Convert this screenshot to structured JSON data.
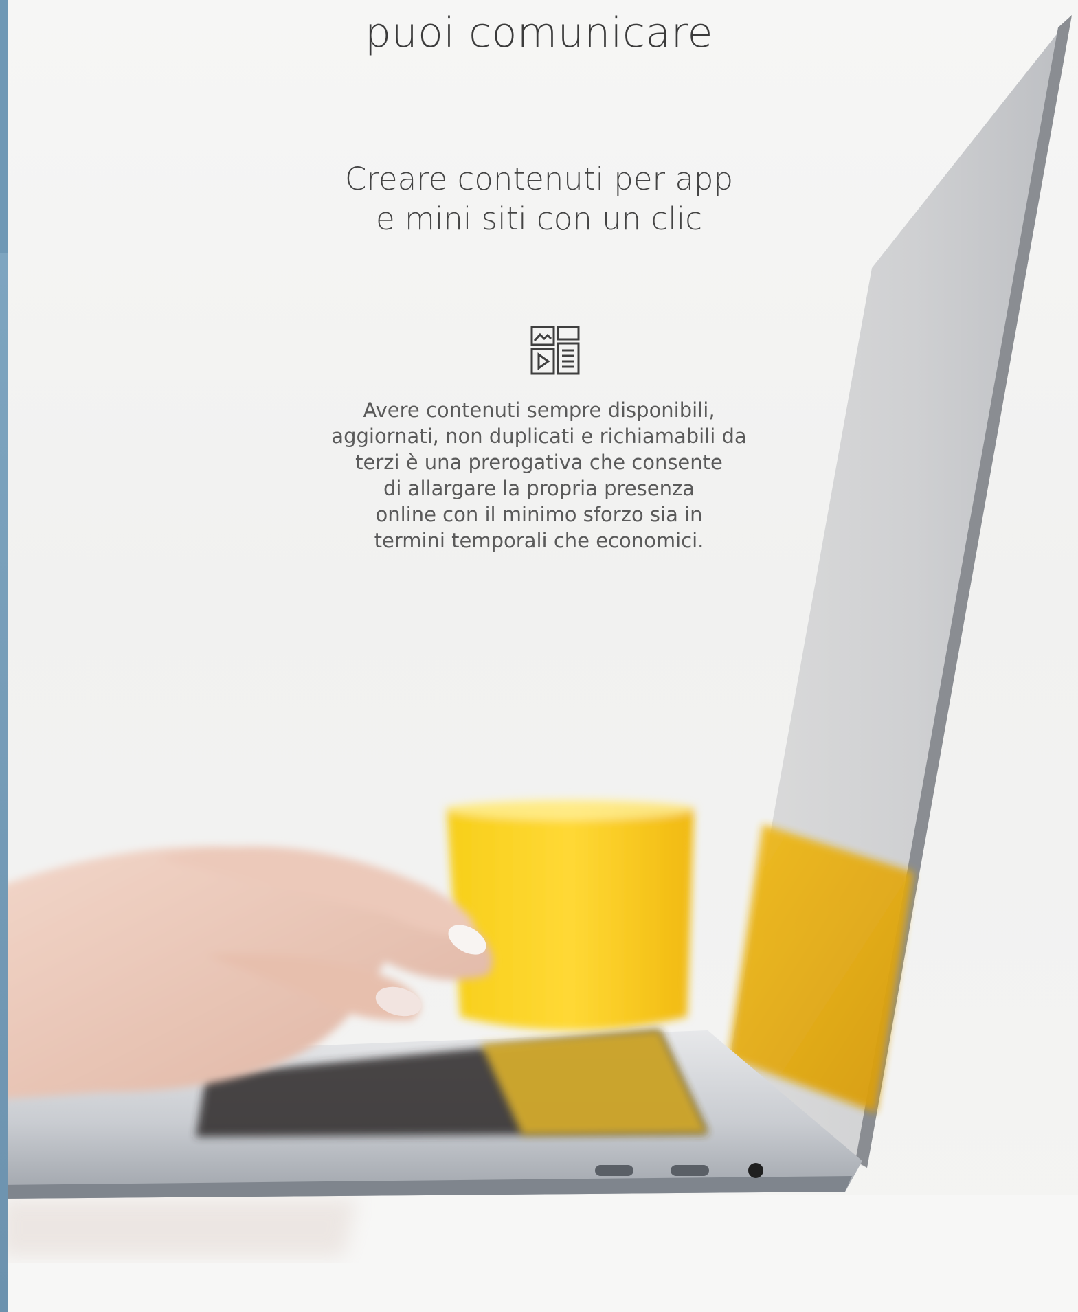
{
  "hero": {
    "headline": "puoi comunicare",
    "subtitle_lines": [
      "Creare contenuti per app",
      "e mini siti con un clic"
    ],
    "icon": "content-layout-icon",
    "description_lines": [
      "Avere contenuti sempre disponibili,",
      "aggiornati, non duplicati e richiamabili da",
      "terzi è una prerogativa che consente",
      "di allargare la propria presenza",
      "online con il minimo sforzo sia in",
      "termini temporali che economici."
    ]
  },
  "colors": {
    "background": "#f3f3f2",
    "side_strip": "#6f98b5",
    "text": "#3b3b3b",
    "accent_yellow": "#f2c417"
  }
}
